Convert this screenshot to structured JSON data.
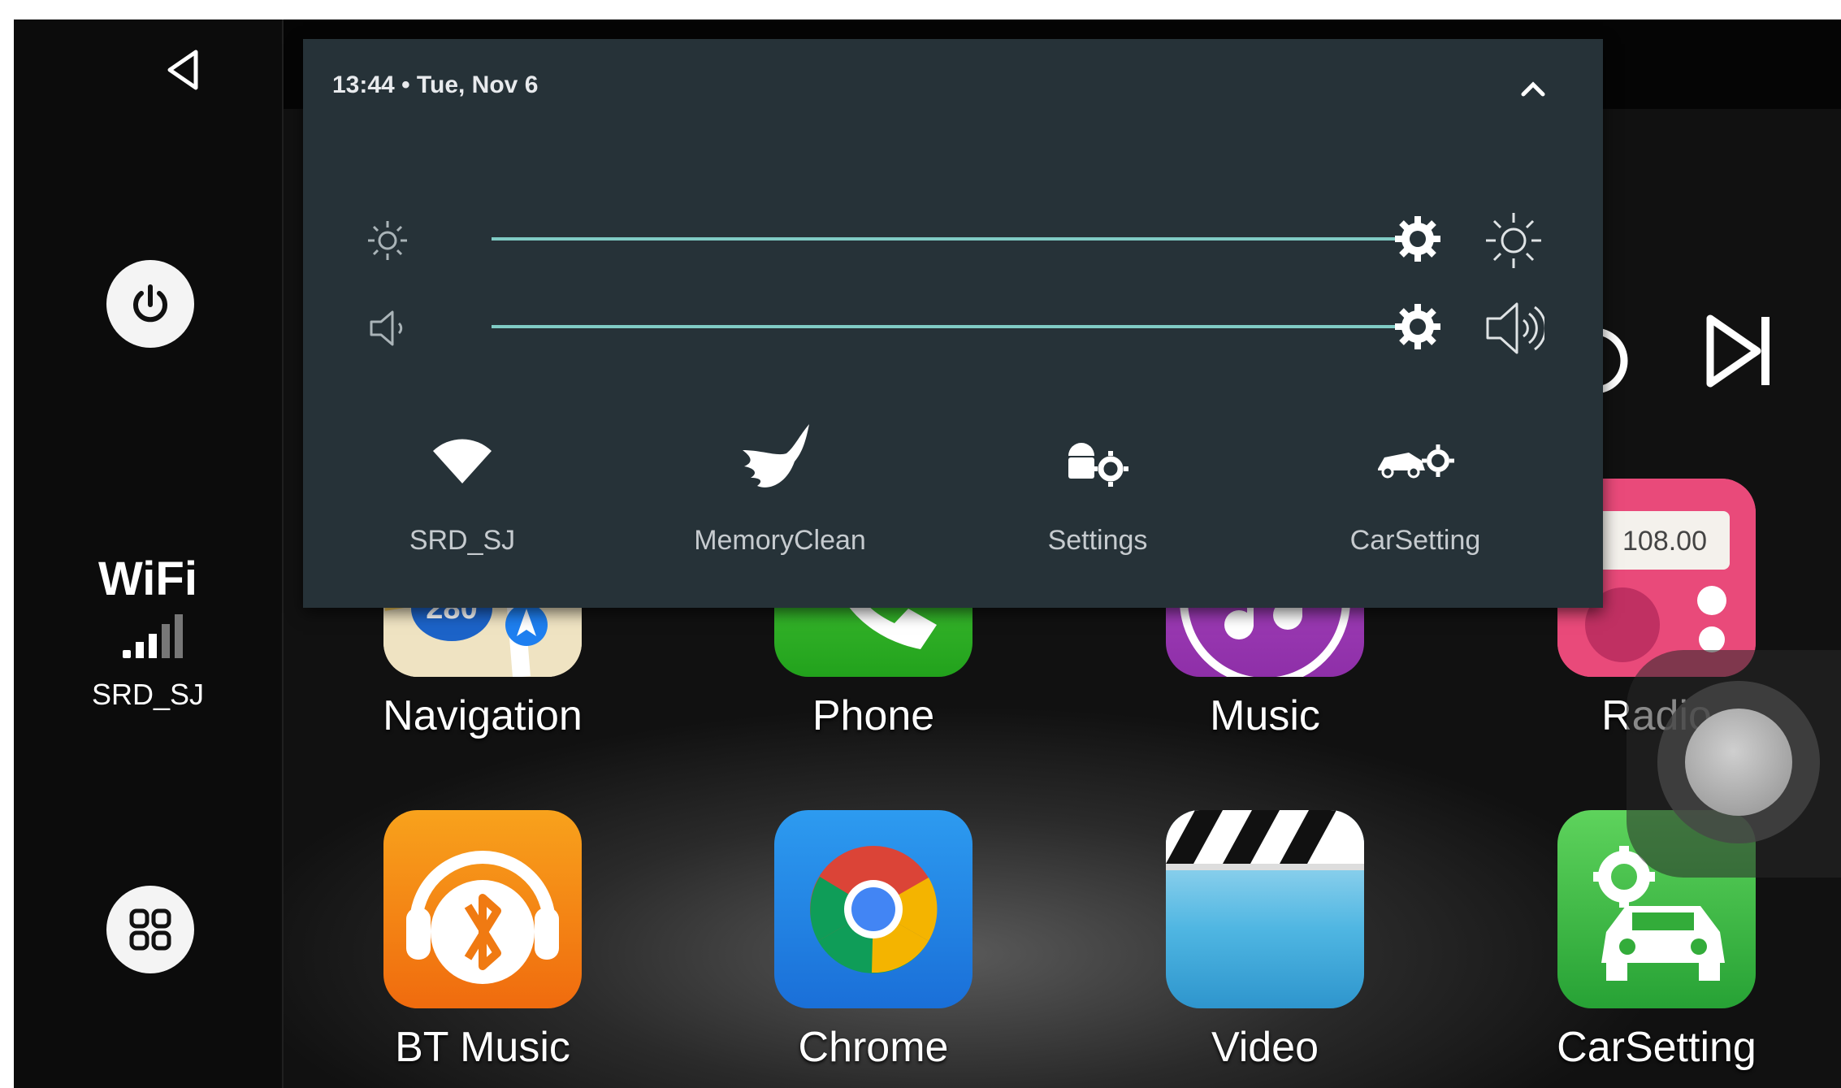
{
  "status": {
    "datetime": "13:44 • Tue, Nov 6"
  },
  "sidebar": {
    "wifi_title": "WiFi",
    "wifi_network": "SRD_SJ",
    "icons": [
      "back-icon",
      "power-icon",
      "apps-grid-icon"
    ]
  },
  "quick_settings": {
    "brightness": {
      "level": 1.0,
      "left_icon": "brightness-low-icon",
      "right_icon": "brightness-high-icon"
    },
    "volume": {
      "level": 1.0,
      "left_icon": "volume-low-icon",
      "right_icon": "volume-high-icon"
    },
    "tiles": [
      {
        "label": "SRD_SJ",
        "icon": "wifi-icon"
      },
      {
        "label": "MemoryClean",
        "icon": "memory-clean-icon"
      },
      {
        "label": "Settings",
        "icon": "settings-icon"
      },
      {
        "label": "CarSetting",
        "icon": "car-setting-icon"
      }
    ]
  },
  "media": {
    "icons": [
      "play-pause-icon",
      "skip-next-icon"
    ]
  },
  "radio_display": "108.00",
  "navigation_badge": "280",
  "apps": [
    {
      "label": "Navigation",
      "icon": "navigation-icon"
    },
    {
      "label": "Phone",
      "icon": "phone-icon"
    },
    {
      "label": "Music",
      "icon": "music-icon"
    },
    {
      "label": "Radio",
      "icon": "radio-icon"
    },
    {
      "label": "BT Music",
      "icon": "bt-music-icon"
    },
    {
      "label": "Chrome",
      "icon": "chrome-icon"
    },
    {
      "label": "Video",
      "icon": "video-icon"
    },
    {
      "label": "CarSetting",
      "icon": "car-setting-app-icon"
    }
  ],
  "colors": {
    "panel": "#263238",
    "slider": "#80cbc4",
    "background": "#0b0b0b"
  }
}
